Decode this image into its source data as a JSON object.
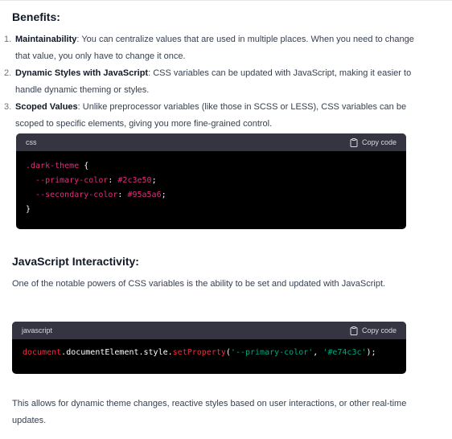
{
  "sections": {
    "benefits_heading": "Benefits:",
    "benefits": [
      {
        "number": "1.",
        "title": "Maintainability",
        "text": ": You can centralize values that are used in multiple places. When you need to change that value, you only have to change it once."
      },
      {
        "number": "2.",
        "title": "Dynamic Styles with JavaScript",
        "text": ": CSS variables can be updated with JavaScript, making it easier to handle dynamic theming or styles."
      },
      {
        "number": "3.",
        "title": "Scoped Values",
        "text": ": Unlike preprocessor variables (like those in SCSS or LESS), CSS variables can be scoped to specific elements, giving you more fine-grained control."
      }
    ],
    "css_block": {
      "language": "css",
      "copy_label": "Copy code",
      "line1_selector": ".dark-theme",
      "line1_brace": " {",
      "line2_prop": "--primary-color",
      "line2_colon": ": ",
      "line2_value": "#2c3e50",
      "line2_end": ";",
      "line3_prop": "--secondary-color",
      "line3_colon": ": ",
      "line3_value": "#95a5a6",
      "line3_end": ";",
      "line4": "}"
    },
    "js_heading": "JavaScript Interactivity:",
    "js_intro": "One of the notable powers of CSS variables is the ability to be set and updated with JavaScript.",
    "js_block": {
      "language": "javascript",
      "copy_label": "Copy code",
      "tok1": "document",
      "tok2": ".documentElement.style.",
      "tok3": "setProperty",
      "tok4": "(",
      "tok5": "'--primary-color'",
      "tok6": ", ",
      "tok7": "'#e74c3c'",
      "tok8": ");"
    },
    "closing": "This allows for dynamic theme changes, reactive styles based on user interactions, or other real-time updates."
  },
  "icons": {
    "copy": "clipboard-icon"
  },
  "colors": {
    "code_bg": "#000000",
    "code_header_bg": "#343541",
    "keyword_pink": "#df3079",
    "function_red": "#f22c3d",
    "string_green": "#00a67d"
  }
}
